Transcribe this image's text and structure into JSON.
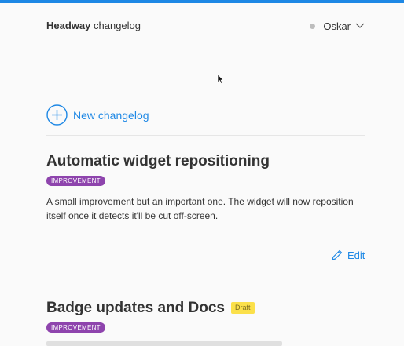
{
  "header": {
    "brand_bold": "Headway",
    "brand_rest": "changelog",
    "user_name": "Oskar"
  },
  "actions": {
    "new_changelog": "New changelog"
  },
  "posts": [
    {
      "title": "Automatic widget repositioning",
      "badge": "IMPROVEMENT",
      "body": "A small improvement but an important one. The widget will now reposition itself once it detects it'll be cut off-screen.",
      "edit_label": "Edit"
    },
    {
      "title": "Badge updates and Docs",
      "draft_label": "Draft",
      "badge": "IMPROVEMENT"
    }
  ],
  "colors": {
    "accent": "#1e88e5",
    "badge": "#8e44ad",
    "draft": "#fbe04a"
  }
}
